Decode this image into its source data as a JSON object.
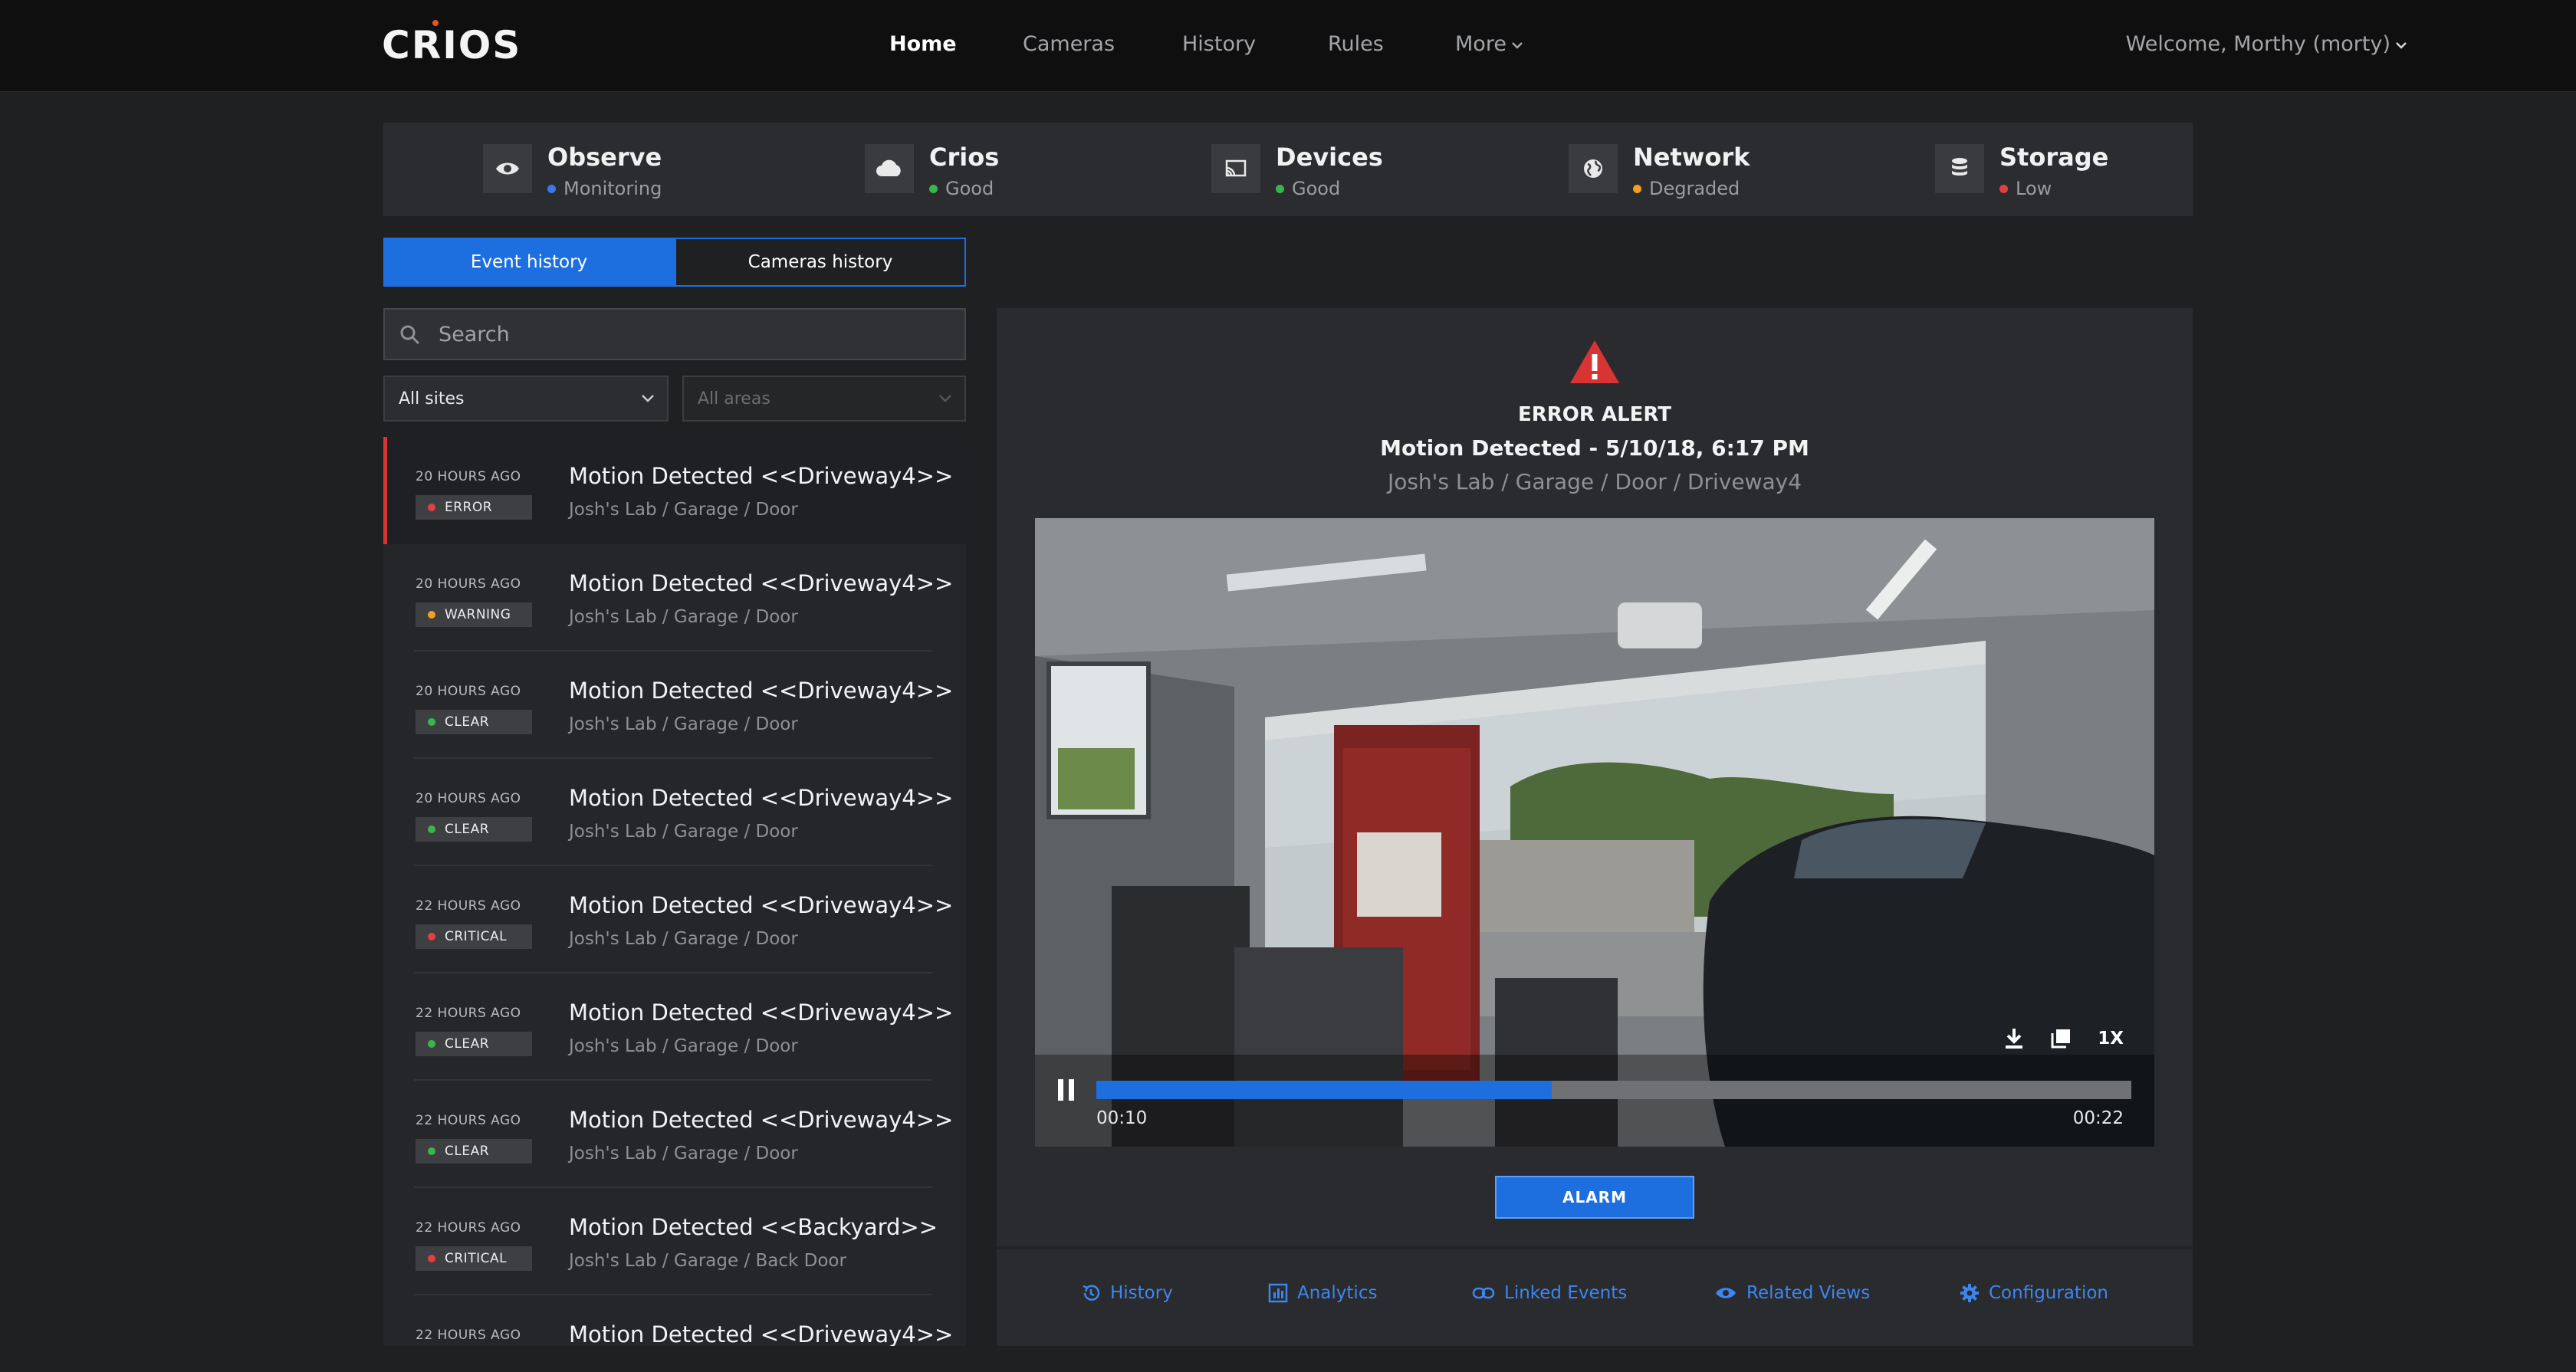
{
  "app": {
    "logo_text": "CRIOS"
  },
  "nav": {
    "home": "Home",
    "cameras": "Cameras",
    "history": "History",
    "rules": "Rules",
    "more": "More",
    "user": "Welcome, Morthy (morty)"
  },
  "status": [
    {
      "title": "Observe",
      "state": "Monitoring",
      "color": "#3b78e7",
      "icon": "eye-icon"
    },
    {
      "title": "Crios",
      "state": "Good",
      "color": "#3bb54a",
      "icon": "cloud-icon"
    },
    {
      "title": "Devices",
      "state": "Good",
      "color": "#3bb54a",
      "icon": "cast-icon"
    },
    {
      "title": "Network",
      "state": "Degraded",
      "color": "#f0a020",
      "icon": "globe-icon"
    },
    {
      "title": "Storage",
      "state": "Low",
      "color": "#e04040",
      "icon": "database-icon"
    }
  ],
  "tabs": {
    "event_history": "Event history",
    "cameras_history": "Cameras history"
  },
  "search": {
    "placeholder": "Search"
  },
  "filters": {
    "sites": "All sites",
    "areas": "All areas"
  },
  "events": [
    {
      "time": "20 HOURS AGO",
      "badge": "ERROR",
      "badge_color": "#e04040",
      "title": "Motion Detected <<Driveway4>>",
      "path": "Josh's Lab / Garage / Door"
    },
    {
      "time": "20 HOURS AGO",
      "badge": "WARNING",
      "badge_color": "#f0a020",
      "title": "Motion Detected <<Driveway4>>",
      "path": "Josh's Lab / Garage / Door"
    },
    {
      "time": "20 HOURS AGO",
      "badge": "CLEAR",
      "badge_color": "#3bb54a",
      "title": "Motion Detected <<Driveway4>>",
      "path": "Josh's Lab / Garage / Door"
    },
    {
      "time": "20 HOURS AGO",
      "badge": "CLEAR",
      "badge_color": "#3bb54a",
      "title": "Motion Detected <<Driveway4>>",
      "path": "Josh's Lab / Garage / Door"
    },
    {
      "time": "22 HOURS AGO",
      "badge": "CRITICAL",
      "badge_color": "#e04040",
      "title": "Motion Detected <<Driveway4>>",
      "path": "Josh's Lab / Garage / Door"
    },
    {
      "time": "22 HOURS AGO",
      "badge": "CLEAR",
      "badge_color": "#3bb54a",
      "title": "Motion Detected <<Driveway4>>",
      "path": "Josh's Lab / Garage / Door"
    },
    {
      "time": "22 HOURS AGO",
      "badge": "CLEAR",
      "badge_color": "#3bb54a",
      "title": "Motion Detected <<Driveway4>>",
      "path": "Josh's Lab / Garage / Door"
    },
    {
      "time": "22 HOURS AGO",
      "badge": "CRITICAL",
      "badge_color": "#e04040",
      "title": "Motion Detected <<Backyard>>",
      "path": "Josh's Lab / Garage / Back Door"
    },
    {
      "time": "22 HOURS AGO",
      "badge": "",
      "badge_color": "#3bb54a",
      "title": "Motion Detected <<Driveway4>>",
      "path": ""
    }
  ],
  "detail": {
    "level": "ERROR ALERT",
    "title": "Motion Detected - 5/10/18, 6:17 PM",
    "path": "Josh's Lab / Garage / Door / Driveway4",
    "alarm_label": "ALARM",
    "video": {
      "current": "00:10",
      "duration": "00:22",
      "progress_fraction": 0.44,
      "speed": "1X",
      "tools": [
        "download-icon",
        "copy-icon"
      ]
    },
    "footer_tabs": [
      {
        "label": "History",
        "icon": "history-icon"
      },
      {
        "label": "Analytics",
        "icon": "analytics-icon"
      },
      {
        "label": "Linked Events",
        "icon": "link-icon"
      },
      {
        "label": "Related Views",
        "icon": "eye-icon"
      },
      {
        "label": "Configuration",
        "icon": "gear-icon"
      }
    ]
  },
  "colors": {
    "accent": "#1d6fe0",
    "error": "#d83434",
    "background": "#1f2022"
  }
}
